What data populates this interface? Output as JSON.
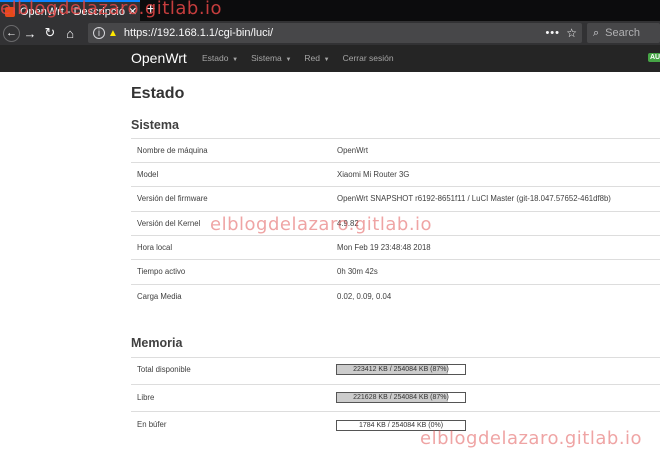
{
  "browser": {
    "tab_title": "OpenWrt - Descripción",
    "tab_close": "✕",
    "new_tab": "+",
    "url": "https://192.168.1.1/cgi-bin/luci/",
    "url_menu": "•••",
    "search_placeholder": "Search"
  },
  "luci": {
    "brand": "OpenWrt",
    "menu": [
      {
        "label": "Estado"
      },
      {
        "label": "Sistema"
      },
      {
        "label": "Red"
      },
      {
        "label": "Cerrar sesión"
      }
    ],
    "badge": "AU"
  },
  "page": {
    "title": "Estado"
  },
  "system": {
    "title": "Sistema",
    "rows": [
      {
        "label": "Nombre de máquina",
        "value": "OpenWrt"
      },
      {
        "label": "Model",
        "value": "Xiaomi Mi Router 3G"
      },
      {
        "label": "Versión del firmware",
        "value": "OpenWrt SNAPSHOT r6192-8651f11 / LuCI Master (git-18.047.57652-461df8b)"
      },
      {
        "label": "Versión del Kernel",
        "value": "4.9.82"
      },
      {
        "label": "Hora local",
        "value": "Mon Feb 19 23:48:48 2018"
      },
      {
        "label": "Tiempo activo",
        "value": "0h 30m 42s"
      },
      {
        "label": "Carga Media",
        "value": "0.02, 0.09, 0.04"
      }
    ]
  },
  "memory": {
    "title": "Memoria",
    "rows": [
      {
        "label": "Total disponible",
        "bar_text": "223412 KB / 254084 KB (87%)",
        "percent": 87
      },
      {
        "label": "Libre",
        "bar_text": "221628 KB / 254084 KB (87%)",
        "percent": 87
      },
      {
        "label": "En búfer",
        "bar_text": "1784 KB / 254084 KB (0%)",
        "percent": 0
      }
    ]
  },
  "watermark": {
    "text": "elblogdelazaro.gitlab.io"
  },
  "colors": {
    "accent": "#0a84ff",
    "header_bg": "#252525",
    "badge": "#46a546",
    "watermark": "#e15a5a"
  }
}
